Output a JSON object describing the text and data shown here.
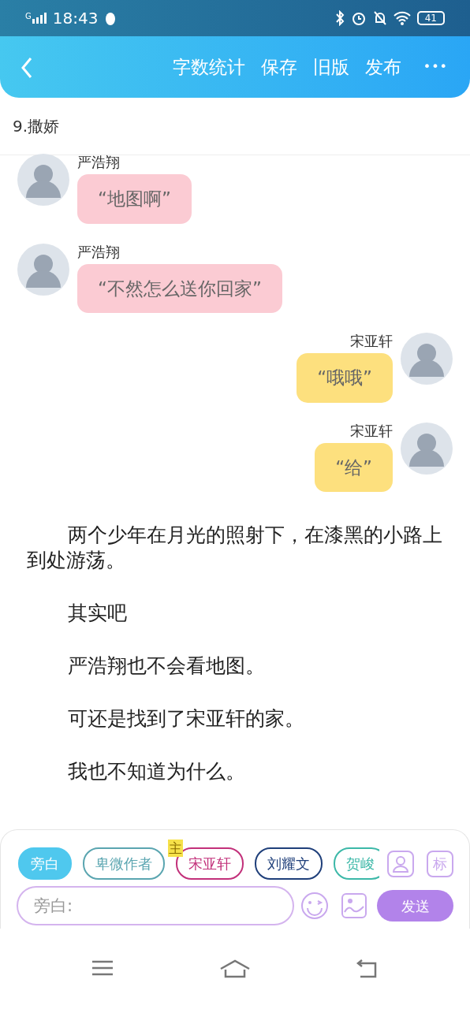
{
  "status_bar": {
    "time": "18:43",
    "signal_label": "G",
    "battery": "41"
  },
  "header": {
    "actions": [
      "字数统计",
      "保存",
      "旧版",
      "发布"
    ],
    "more": "•••"
  },
  "chapter_title": "9.撒娇",
  "messages": [
    {
      "kind": "incoming",
      "name": "严浩翔",
      "text": "“地图啊”"
    },
    {
      "kind": "incoming",
      "name": "严浩翔",
      "text": "“不然怎么送你回家”"
    },
    {
      "kind": "outgoing",
      "name": "宋亚轩",
      "text": "“哦哦”"
    },
    {
      "kind": "outgoing",
      "name": "宋亚轩",
      "text": "“给”"
    }
  ],
  "paragraphs": [
    "两个少年在月光的照射下，在漆黑的小路上到处游荡。",
    "其实吧",
    "严浩翔也不会看地图。",
    "可还是找到了宋亚轩的家。",
    "我也不知道为什么。"
  ],
  "characters": [
    {
      "label": "旁白",
      "selected": true,
      "color": "#4fc8ee"
    },
    {
      "label": "卑微作者",
      "selected": false,
      "color": "#5aa5b0"
    },
    {
      "label": "宋亚轩",
      "selected": false,
      "color": "#c2307a",
      "badge": "主"
    },
    {
      "label": "刘耀文",
      "selected": false,
      "color": "#1f3f7a"
    },
    {
      "label": "贺峻",
      "selected": false,
      "color": "#3cb8a8"
    }
  ],
  "tag_button": "标",
  "input": {
    "placeholder": "旁白:"
  },
  "send_button": "发送"
}
